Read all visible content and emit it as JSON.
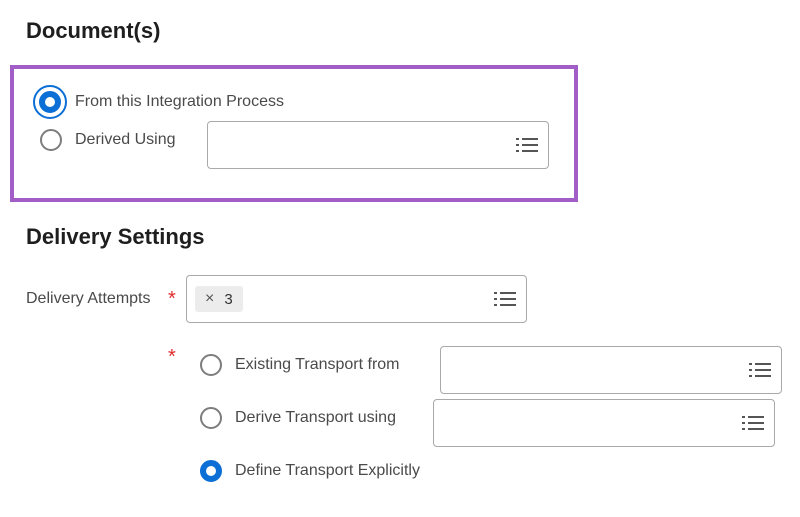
{
  "documents": {
    "heading": "Document(s)",
    "options": [
      {
        "label": "From this Integration Process",
        "selected": true
      },
      {
        "label": "Derived Using",
        "selected": false
      }
    ]
  },
  "delivery": {
    "heading": "Delivery Settings",
    "attempts_label": "Delivery Attempts",
    "required_mark": "*",
    "attempts_value": "3",
    "chip_remove": "×",
    "transport_options": [
      {
        "label": "Existing Transport from",
        "selected": false
      },
      {
        "label": "Derive Transport using",
        "selected": false
      },
      {
        "label": "Define Transport Explicitly",
        "selected": true
      }
    ]
  },
  "icons": {
    "list": "list-icon",
    "radio_selected": "radio-selected-icon",
    "radio_unselected": "radio-unselected-icon"
  },
  "colors": {
    "accent": "#0b6fd6",
    "highlight_border": "#a05ec6",
    "required": "#de2c2c"
  }
}
